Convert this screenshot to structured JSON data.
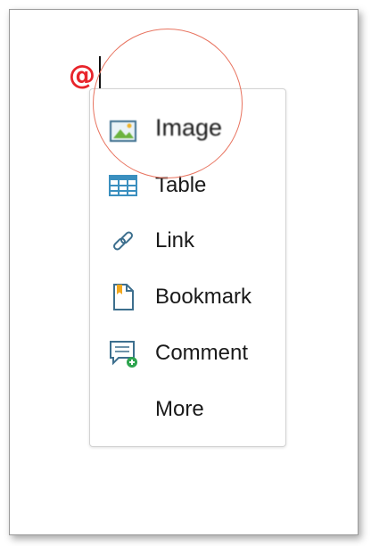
{
  "editor": {
    "typed_char": "@"
  },
  "menu": {
    "items": [
      {
        "label": "Image",
        "icon": "image-icon"
      },
      {
        "label": "Table",
        "icon": "table-icon"
      },
      {
        "label": "Link",
        "icon": "link-icon"
      },
      {
        "label": "Bookmark",
        "icon": "bookmark-icon"
      },
      {
        "label": "Comment",
        "icon": "comment-icon"
      },
      {
        "label": "More",
        "icon": ""
      }
    ]
  },
  "colors": {
    "at_sign": "#e8242b",
    "highlight": "#e8735f",
    "icon_blue": "#3a8fbf",
    "comment_plus": "#2ea44f"
  }
}
